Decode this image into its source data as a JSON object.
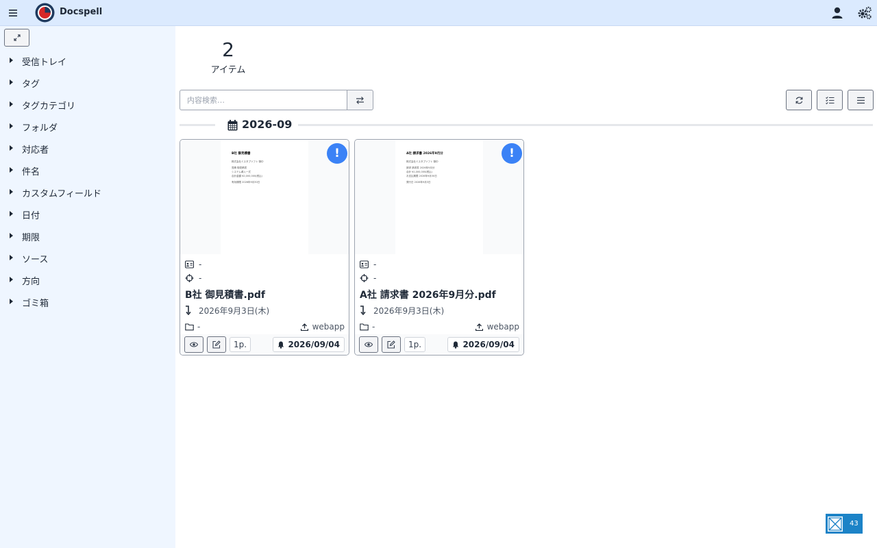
{
  "app": {
    "title": "Docspell"
  },
  "sidebar": {
    "items": [
      {
        "label": "受信トレイ"
      },
      {
        "label": "タグ"
      },
      {
        "label": "タグカテゴリ"
      },
      {
        "label": "フォルダ"
      },
      {
        "label": "対応者"
      },
      {
        "label": "件名"
      },
      {
        "label": "カスタムフィールド"
      },
      {
        "label": "日付"
      },
      {
        "label": "期限"
      },
      {
        "label": "ソース"
      },
      {
        "label": "方向"
      },
      {
        "label": "ゴミ箱"
      }
    ]
  },
  "summary": {
    "count": "2",
    "count_label": "アイテム"
  },
  "search": {
    "placeholder": "内容検索…",
    "value": ""
  },
  "group": {
    "title": "2026-09"
  },
  "cards": [
    {
      "thumbnail": {
        "title": "B社 御見積書",
        "lines": [
          "株式会社ミスタブソフト 御中",
          "見積 御見積書",
          "システム導入一式",
          "合計金額 ¥2,000,000(税込)",
          "有効期限 2026年9月30日"
        ]
      },
      "correspondent": "-",
      "concerning": "-",
      "name": "B社 御見積書.pdf",
      "date": "2026年9月3日(木)",
      "folder": "-",
      "source": "webapp",
      "pages": "1p.",
      "due": "2026/09/04"
    },
    {
      "thumbnail": {
        "title": "A社 請求書 2026年9月分",
        "lines": [
          "株式会社ミスタブソフト 御中",
          "請求 請求書 2026年9月分",
          "合計 ¥1,000,000(税込)",
          "お支払期限 2026年9月30日",
          "発行日 2026年9月3日"
        ]
      },
      "correspondent": "-",
      "concerning": "-",
      "name": "A社 請求書 2026年9月分.pdf",
      "date": "2026年9月3日(木)",
      "folder": "-",
      "source": "webapp",
      "pages": "1p.",
      "due": "2026/09/04"
    }
  ],
  "notification": {
    "count": "43"
  },
  "colors": {
    "topbar": "#dbeafe",
    "sidebar": "#eff6ff",
    "accent": "#3b82f6",
    "notification": "#1c83c7"
  },
  "icons": {
    "menu": "hamburger-icon",
    "logo": "docspell-logo",
    "user": "user-icon",
    "settings": "gears-icon",
    "expand": "expand-icon",
    "caret": "caret-right-icon",
    "swap": "exchange-icon",
    "reload": "refresh-icon",
    "select": "checklist-icon",
    "list": "list-icon",
    "calendar": "calendar-icon",
    "alert": "exclamation-icon",
    "correspondent": "address-card-icon",
    "concerning": "crosshair-icon",
    "date": "level-down-icon",
    "folder": "folder-icon",
    "source": "upload-icon",
    "preview": "eye-icon",
    "edit": "edit-icon",
    "due": "bell-icon"
  }
}
